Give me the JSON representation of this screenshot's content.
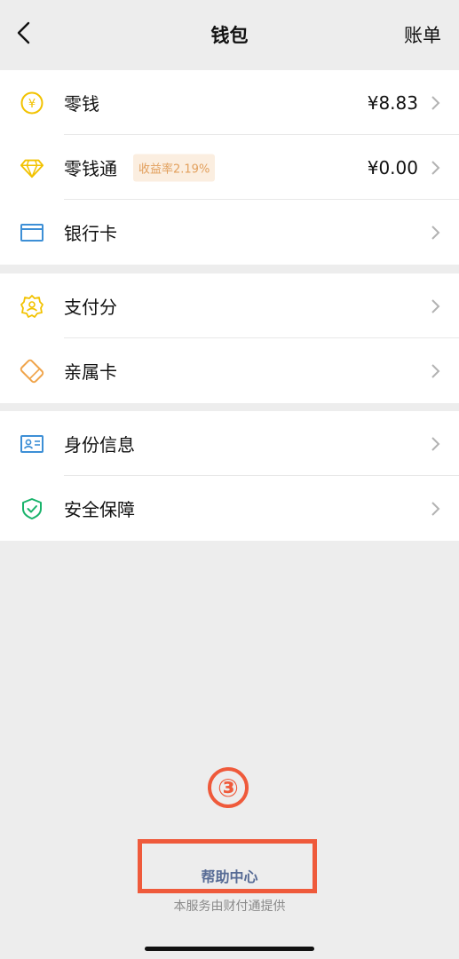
{
  "header": {
    "title": "钱包",
    "right_action": "账单"
  },
  "groups": [
    {
      "items": [
        {
          "label": "零钱",
          "value": "¥8.83",
          "icon": "yuan-coin-icon"
        },
        {
          "label": "零钱通",
          "badge": "收益率2.19%",
          "value": "¥0.00",
          "icon": "diamond-icon"
        },
        {
          "label": "银行卡",
          "icon": "bank-card-icon"
        }
      ]
    },
    {
      "items": [
        {
          "label": "支付分",
          "icon": "pay-score-icon"
        },
        {
          "label": "亲属卡",
          "icon": "family-card-icon"
        }
      ]
    },
    {
      "items": [
        {
          "label": "身份信息",
          "icon": "id-card-icon"
        },
        {
          "label": "安全保障",
          "icon": "shield-check-icon"
        }
      ]
    }
  ],
  "step_marker": "③",
  "help_link": "帮助中心",
  "footer_note": "本服务由财付通提供",
  "colors": {
    "background": "#ededed",
    "icon_yellow": "#f2c200",
    "icon_blue": "#3d8fd6",
    "icon_orange": "#f0a44a",
    "icon_green": "#19b36b",
    "badge_bg": "#fbeee0",
    "badge_text": "#e2a05d",
    "link": "#576b95",
    "annotation_red": "#ef5a3b"
  }
}
